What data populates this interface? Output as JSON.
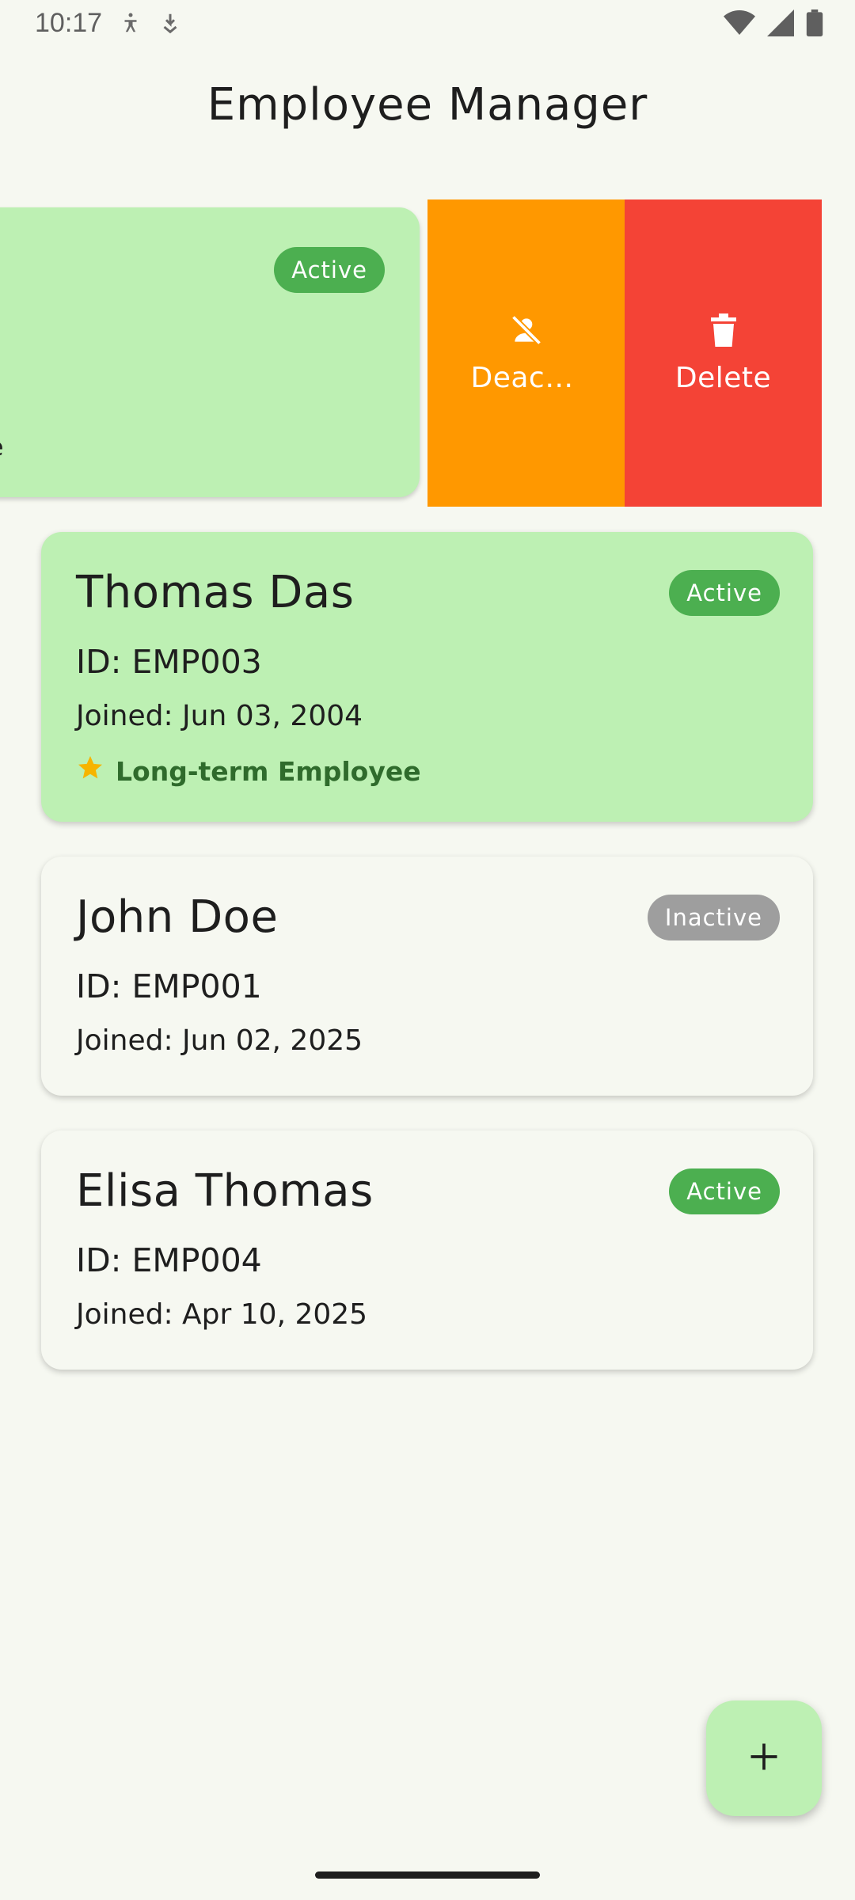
{
  "status_bar": {
    "time": "10:17",
    "left_icons": [
      "accessibility-icon",
      "download-icon"
    ],
    "right_icons": [
      "wifi-icon",
      "signal-icon",
      "battery-icon"
    ]
  },
  "app_bar": {
    "title": "Employee Manager"
  },
  "swiped_card": {
    "status": "Active",
    "edge_text": "e",
    "actions": [
      {
        "label": "Deactivate",
        "icon": "person-off-icon",
        "color": "#ff9800"
      },
      {
        "label": "Delete",
        "icon": "trash-icon",
        "color": "#f44336"
      }
    ]
  },
  "employees": [
    {
      "name": "Thomas Das",
      "id_text": "ID: EMP003",
      "joined_text": "Joined: Jun 03, 2004",
      "status": "Active",
      "note": "Long-term Employee",
      "note_icon": "star-icon",
      "highlight": true
    },
    {
      "name": "John Doe",
      "id_text": "ID: EMP001",
      "joined_text": "Joined: Jun 02, 2025",
      "status": "Inactive",
      "highlight": false
    },
    {
      "name": "Elisa Thomas",
      "id_text": "ID: EMP004",
      "joined_text": "Joined: Apr 10, 2025",
      "status": "Active",
      "highlight": false
    }
  ],
  "fab": {
    "icon": "plus-icon"
  },
  "colors": {
    "background": "#f6f8f1",
    "highlight_card": "#bdf0b3",
    "active_badge": "#4caf50",
    "inactive_badge": "#9e9e9e",
    "deactivate_action": "#ff9800",
    "delete_action": "#f44336",
    "star": "#f6b400",
    "note_text": "#2f6b2c"
  }
}
